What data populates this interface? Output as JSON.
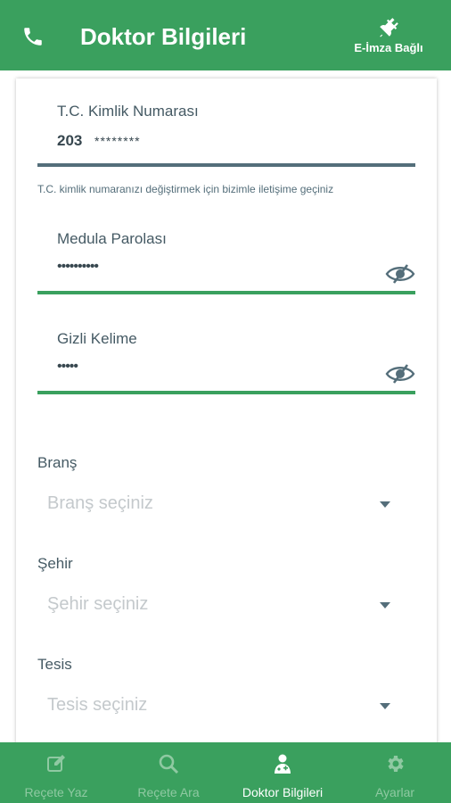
{
  "header": {
    "title": "Doktor Bilgileri",
    "eimza_label": "E-İmza Bağlı",
    "bar_color": "#3aa05e"
  },
  "tc": {
    "label": "T.C. Kimlik Numarası",
    "value_prefix": "203",
    "value_masked": "********",
    "hint": "T.C. kimlik numaranızı değiştirmek için bizimle iletişime geçiniz"
  },
  "medula": {
    "label": "Medula Parolası",
    "value": "••••••••••"
  },
  "gizli": {
    "label": "Gizli Kelime",
    "value": "•••••"
  },
  "brans": {
    "label": "Branş",
    "placeholder": "Branş seçiniz"
  },
  "sehir": {
    "label": "Şehir",
    "placeholder": "Şehir seçiniz"
  },
  "tesis": {
    "label": "Tesis",
    "placeholder": "Tesis seçiniz"
  },
  "nav": {
    "items": [
      {
        "label": "Reçete Yaz",
        "icon": "edit-icon",
        "active": false
      },
      {
        "label": "Reçete Ara",
        "icon": "search-icon",
        "active": false
      },
      {
        "label": "Doktor Bilgileri",
        "icon": "doctor-icon",
        "active": true
      },
      {
        "label": "Ayarlar",
        "icon": "gear-icon",
        "active": false
      }
    ]
  },
  "colors": {
    "accent": "#3aa05e",
    "underline_disabled": "#546e7a",
    "underline_active": "#3aa05e"
  }
}
